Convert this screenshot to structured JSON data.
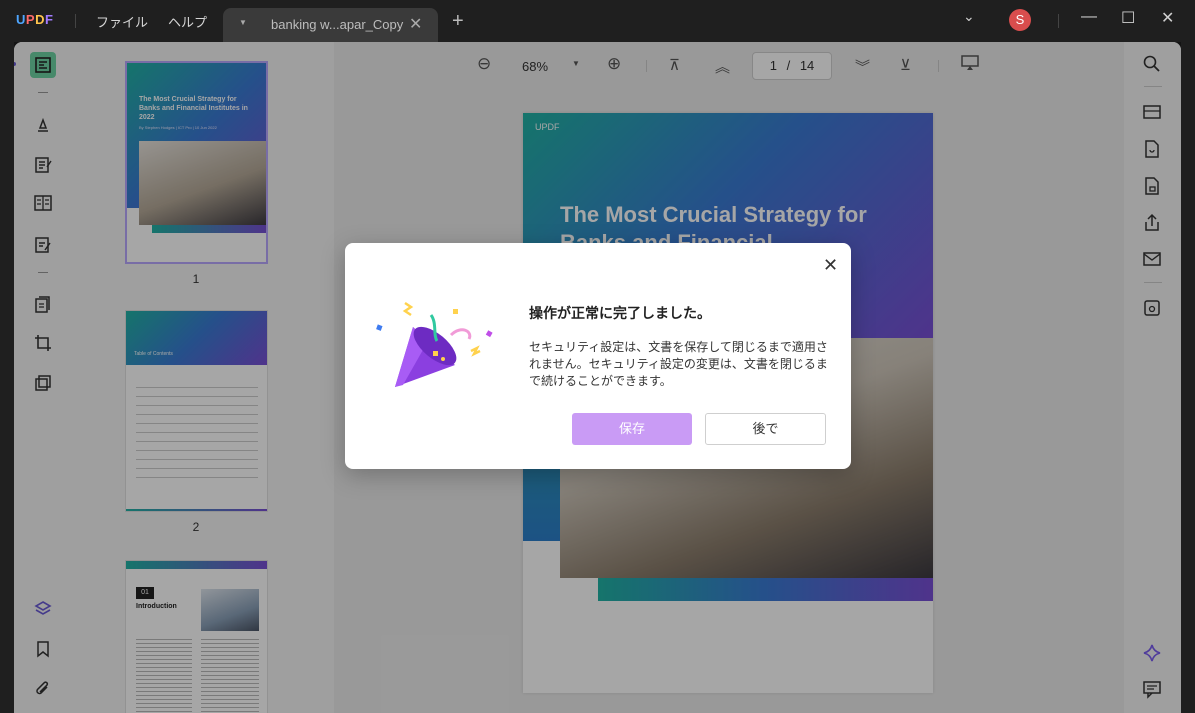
{
  "app": {
    "logo": "UPDF"
  },
  "menu": {
    "file": "ファイル",
    "help": "ヘルプ"
  },
  "tab": {
    "name": "banking w...apar_Copy"
  },
  "user": {
    "initial": "S"
  },
  "viewer": {
    "zoom": "68%",
    "current_page": "1",
    "page_sep": "/",
    "total_pages": "14"
  },
  "thumbnails": [
    {
      "page": "1",
      "title": "The Most Crucial Strategy for Banks and Financial Institutes in 2022",
      "subtitle": "By Stephen Hodges | ICT Pro | 10 Jun 2022"
    },
    {
      "page": "2",
      "title": "Table of Contents"
    },
    {
      "page": "3",
      "num": "01",
      "title": "Introduction"
    }
  ],
  "document": {
    "brand": "UPDF",
    "title": "The Most Crucial Strategy for Banks and Financial"
  },
  "dialog": {
    "title": "操作が正常に完了しました。",
    "message": "セキュリティ設定は、文書を保存して閉じるまで適用されません。セキュリティ設定の変更は、文書を閉じるまで続けることができます。",
    "save_label": "保存",
    "later_label": "後で"
  },
  "colors": {
    "accent": "#c99bf5",
    "active_tool": "#6ed3a4"
  }
}
